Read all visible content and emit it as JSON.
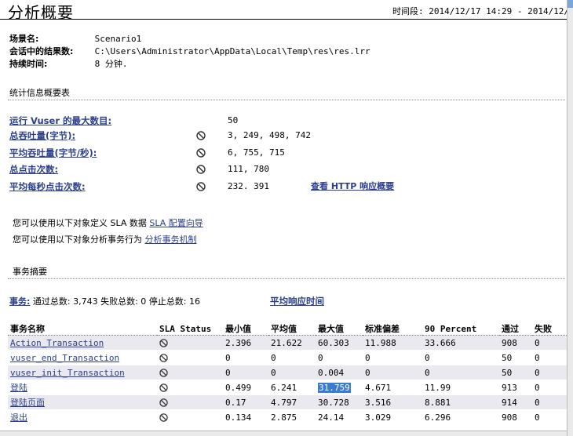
{
  "header": {
    "title": "分析概要",
    "time_range": "时间段: 2014/12/17 14:29 - 2014/12/1"
  },
  "meta": [
    {
      "key": "场景名:",
      "value": "Scenario1"
    },
    {
      "key": "会话中的结果数:",
      "value": "C:\\Users\\Administrator\\AppData\\Local\\Temp\\res\\res.lrr"
    },
    {
      "key": "持续时间:",
      "value": "8 分钟."
    }
  ],
  "stats": {
    "heading": "统计信息概要表",
    "rows": [
      {
        "label": "运行 Vuser 的最大数目:",
        "value": "50",
        "icon": ""
      },
      {
        "label": "总吞吐量(字节):",
        "value": "3, 249, 498, 742",
        "icon": "no-symbol-icon"
      },
      {
        "label": "平均吞吐量(字节/秒):",
        "value": "6, 755, 715",
        "icon": "no-symbol-icon"
      },
      {
        "label": "总点击次数:",
        "value": "111, 780",
        "icon": "no-symbol-icon"
      },
      {
        "label": "平均每秒点击次数:",
        "value": "232. 391",
        "icon": "no-symbol-icon"
      }
    ],
    "http_link": "查看 HTTP 响应概要"
  },
  "info": {
    "sla_text": "您可以使用以下对象定义 SLA 数据",
    "sla_link": "SLA 配置向导",
    "analyze_text": "您可以使用以下对象分析事务行为",
    "analyze_link": "分析事务机制"
  },
  "transactions": {
    "heading": "事务摘要",
    "summary_label": "事务:",
    "summary_text": " 通过总数: 3,743 失败总数: 0 停止总数: 16",
    "avg_link": "平均响应时间",
    "columns": [
      "事务名称",
      "SLA Status",
      "最小值",
      "平均值",
      "最大值",
      "标准偏差",
      "90 Percent",
      "通过",
      "失败"
    ],
    "rows": [
      {
        "name": "Action_Transaction",
        "min": "2.396",
        "avg": "21.622",
        "max": "60.303",
        "std": "11.988",
        "p90": "33.666",
        "pass": "908",
        "fail": "0"
      },
      {
        "name": "vuser_end_Transaction",
        "min": "0",
        "avg": "0",
        "max": "0",
        "std": "0",
        "p90": "0",
        "pass": "50",
        "fail": "0"
      },
      {
        "name": "vuser_init_Transaction",
        "min": "0",
        "avg": "0",
        "max": "0.004",
        "std": "0",
        "p90": "0",
        "pass": "50",
        "fail": "0"
      },
      {
        "name": "登陆",
        "min": "0.499",
        "avg": "6.241",
        "max": "31.759",
        "std": "4.671",
        "p90": "11.99",
        "pass": "913",
        "fail": "0"
      },
      {
        "name": "登陆页面",
        "min": "0.17",
        "avg": "4.797",
        "max": "30.728",
        "std": "3.516",
        "p90": "8.881",
        "pass": "914",
        "fail": "0"
      },
      {
        "name": "退出",
        "min": "0.134",
        "avg": "2.875",
        "max": "24.14",
        "std": "3.029",
        "p90": "6.296",
        "pass": "908",
        "fail": "0"
      }
    ]
  }
}
